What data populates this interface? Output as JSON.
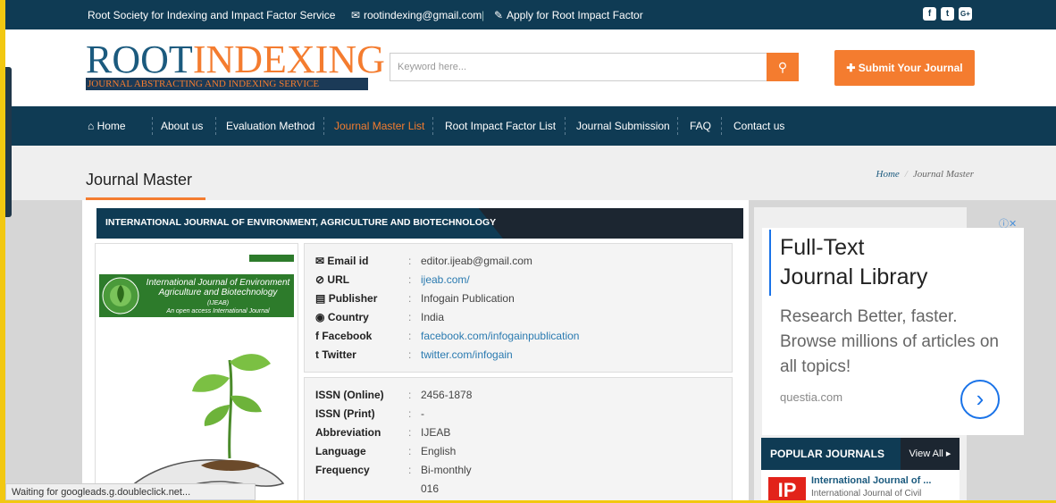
{
  "topbar": {
    "tagline": "Root Society for Indexing and Impact Factor Service",
    "email": "rootindexing@gmail.com",
    "divider": "|",
    "apply": "Apply for Root Impact Factor",
    "social": [
      "f",
      "t",
      "G+"
    ]
  },
  "logo": {
    "main_a": "R",
    "main_b": "OO",
    "main_c": "T",
    "main_d": "INDEXING",
    "sub": "JOURNAL ABSTRACTING AND INDEXING SERVICE"
  },
  "search": {
    "placeholder": "Keyword here..."
  },
  "submit_label": "Submit Your Journal",
  "nav": [
    {
      "label": "Home"
    },
    {
      "label": "About us"
    },
    {
      "label": "Evaluation Method"
    },
    {
      "label": "Journal Master List",
      "active": true
    },
    {
      "label": "Root Impact Factor List"
    },
    {
      "label": "Journal Submission"
    },
    {
      "label": "FAQ"
    },
    {
      "label": "Contact us"
    }
  ],
  "page_title": "Journal Master",
  "breadcrumb": {
    "home": "Home",
    "sep": "/",
    "current": "Journal Master"
  },
  "journal": {
    "title": "INTERNATIONAL JOURNAL OF ENVIRONMENT, AGRICULTURE AND BIOTECHNOLOGY",
    "cover_title": "International Journal of Environment Agriculture and Biotechnology",
    "cover_abbr": "(IJEAB)",
    "cover_tag": "An open access International Journal",
    "contact": [
      {
        "icon": "✉",
        "label": "Email id",
        "value": "editor.ijeab@gmail.com"
      },
      {
        "icon": "⊘",
        "label": "URL",
        "value": "ijeab.com/",
        "link": true
      },
      {
        "icon": "▤",
        "label": "Publisher",
        "value": "Infogain Publication"
      },
      {
        "icon": "◉",
        "label": "Country",
        "value": "India"
      },
      {
        "icon": "f",
        "label": "Facebook",
        "value": "facebook.com/infogainpublication",
        "link": true
      },
      {
        "icon": "t",
        "label": "Twitter",
        "value": "twitter.com/infogain",
        "link": true
      }
    ],
    "details": [
      {
        "label": "ISSN (Online)",
        "value": "2456-1878"
      },
      {
        "label": "ISSN (Print)",
        "value": "-"
      },
      {
        "label": "Abbreviation",
        "value": "IJEAB"
      },
      {
        "label": "Language",
        "value": "English"
      },
      {
        "label": "Frequency",
        "value": "Bi-monthly"
      },
      {
        "label": "",
        "value": "016"
      }
    ],
    "colon": ":"
  },
  "ad": {
    "headline_1": "Full-Text",
    "headline_2": "Journal Library",
    "body": "Research Better, faster. Browse millions of articles on all topics!",
    "source": "questia.com",
    "arrow": "›",
    "choice": "ⓘ✕"
  },
  "popular": {
    "title": "POPULAR JOURNALS",
    "view_all": "View All ▸",
    "item_title": "International Journal of ...",
    "item_sub": "International Journal of Civil",
    "item_logo": "IP"
  },
  "status": "Waiting for googleads.g.doubleclick.net...",
  "colors": {
    "navy": "#0f3b54",
    "orange": "#f47c2f",
    "green": "#2d7b2b"
  }
}
